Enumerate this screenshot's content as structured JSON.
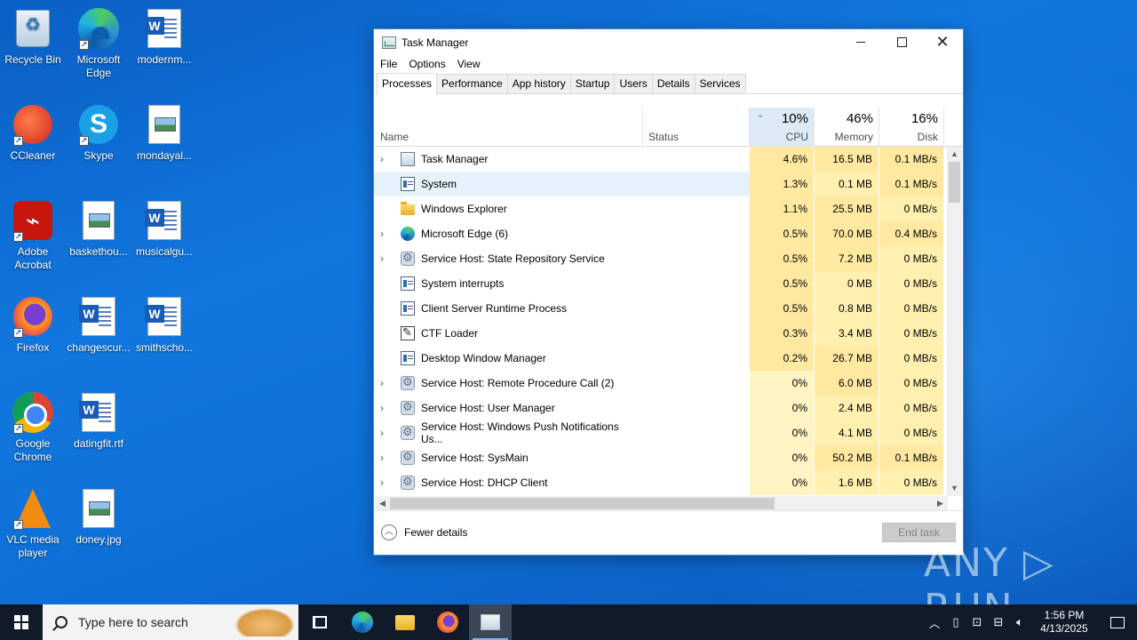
{
  "desktop": {
    "icons": [
      {
        "label": "Recycle Bin"
      },
      {
        "label": "Microsoft Edge"
      },
      {
        "label": "modernm..."
      },
      {
        "label": "CCleaner"
      },
      {
        "label": "Skype"
      },
      {
        "label": "mondayal..."
      },
      {
        "label": "Adobe Acrobat"
      },
      {
        "label": "baskethou..."
      },
      {
        "label": "musicalgu..."
      },
      {
        "label": "Firefox"
      },
      {
        "label": "changescur..."
      },
      {
        "label": "smithscho..."
      },
      {
        "label": "Google Chrome"
      },
      {
        "label": "datingfit.rtf"
      },
      {
        "label": "VLC media player"
      },
      {
        "label": "doney.jpg"
      }
    ]
  },
  "window": {
    "title": "Task Manager",
    "close_glyph": "✕"
  },
  "menu": [
    "File",
    "Options",
    "View"
  ],
  "tabs": [
    "Processes",
    "Performance",
    "App history",
    "Startup",
    "Users",
    "Details",
    "Services"
  ],
  "active_tab": "Processes",
  "columns": {
    "name": "Name",
    "status": "Status",
    "cpu": {
      "percent": "10%",
      "label": "CPU"
    },
    "memory": {
      "percent": "46%",
      "label": "Memory"
    },
    "disk": {
      "percent": "16%",
      "label": "Disk"
    }
  },
  "processes": [
    {
      "name": "Task Manager",
      "cpu": "4.6%",
      "memory": "16.5 MB",
      "disk": "0.1 MB/s",
      "icon": "taskmgr-icon",
      "expandable": true
    },
    {
      "name": "System",
      "cpu": "1.3%",
      "memory": "0.1 MB",
      "disk": "0.1 MB/s",
      "icon": "system-icon",
      "expandable": false,
      "selected": true
    },
    {
      "name": "Windows Explorer",
      "cpu": "1.1%",
      "memory": "25.5 MB",
      "disk": "0 MB/s",
      "icon": "folder-icon",
      "expandable": false
    },
    {
      "name": "Microsoft Edge (6)",
      "cpu": "0.5%",
      "memory": "70.0 MB",
      "disk": "0.4 MB/s",
      "icon": "edge-icon",
      "expandable": true
    },
    {
      "name": "Service Host: State Repository Service",
      "cpu": "0.5%",
      "memory": "7.2 MB",
      "disk": "0 MB/s",
      "icon": "gear-icon",
      "expandable": true
    },
    {
      "name": "System interrupts",
      "cpu": "0.5%",
      "memory": "0 MB",
      "disk": "0 MB/s",
      "icon": "system-icon",
      "expandable": false
    },
    {
      "name": "Client Server Runtime Process",
      "cpu": "0.5%",
      "memory": "0.8 MB",
      "disk": "0 MB/s",
      "icon": "system-icon",
      "expandable": false
    },
    {
      "name": "CTF Loader",
      "cpu": "0.3%",
      "memory": "3.4 MB",
      "disk": "0 MB/s",
      "icon": "ctf-icon",
      "expandable": false
    },
    {
      "name": "Desktop Window Manager",
      "cpu": "0.2%",
      "memory": "26.7 MB",
      "disk": "0 MB/s",
      "icon": "system-icon",
      "expandable": false
    },
    {
      "name": "Service Host: Remote Procedure Call (2)",
      "cpu": "0%",
      "memory": "6.0 MB",
      "disk": "0 MB/s",
      "icon": "gear-icon",
      "expandable": true
    },
    {
      "name": "Service Host: User Manager",
      "cpu": "0%",
      "memory": "2.4 MB",
      "disk": "0 MB/s",
      "icon": "gear-icon",
      "expandable": true
    },
    {
      "name": "Service Host: Windows Push Notifications Us...",
      "cpu": "0%",
      "memory": "4.1 MB",
      "disk": "0 MB/s",
      "icon": "gear-icon",
      "expandable": true
    },
    {
      "name": "Service Host: SysMain",
      "cpu": "0%",
      "memory": "50.2 MB",
      "disk": "0.1 MB/s",
      "icon": "gear-icon",
      "expandable": true
    },
    {
      "name": "Service Host: DHCP Client",
      "cpu": "0%",
      "memory": "1.6 MB",
      "disk": "0 MB/s",
      "icon": "gear-icon",
      "expandable": true
    }
  ],
  "footer": {
    "fewer_details": "Fewer details",
    "end_task": "End task"
  },
  "watermark": "ANY ▷ RUN",
  "taskbar": {
    "search_placeholder": "Type here to search",
    "time": "1:56 PM",
    "date": "4/13/2025"
  }
}
